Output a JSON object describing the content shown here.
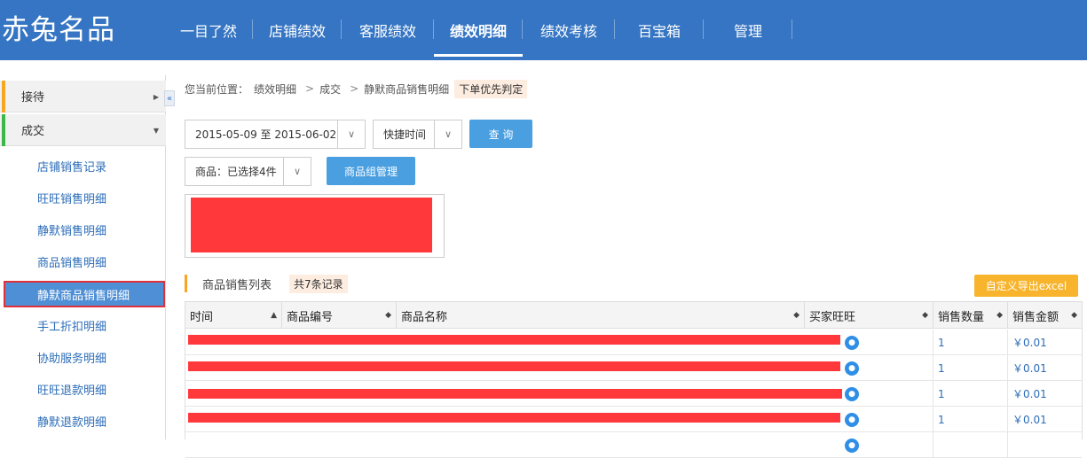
{
  "app": {
    "logo": "赤兔名品"
  },
  "nav": [
    {
      "label": "一目了然"
    },
    {
      "label": "店铺绩效"
    },
    {
      "label": "客服绩效"
    },
    {
      "label": "绩效明细"
    },
    {
      "label": "绩效考核"
    },
    {
      "label": "百宝箱"
    },
    {
      "label": "管理"
    }
  ],
  "nav_active": "绩效明细",
  "sidebar": {
    "groups": [
      {
        "label": "接待",
        "color": "#f5a623",
        "arrow": "▶"
      },
      {
        "label": "成交",
        "color": "#3cb84a",
        "arrow": "▼"
      }
    ],
    "collapse": "«",
    "items": [
      {
        "label": "店铺销售记录"
      },
      {
        "label": "旺旺销售明细"
      },
      {
        "label": "静默销售明细"
      },
      {
        "label": "商品销售明细"
      },
      {
        "label": "静默商品销售明细"
      },
      {
        "label": "手工折扣明细"
      },
      {
        "label": "协助服务明细"
      },
      {
        "label": "旺旺退款明细"
      },
      {
        "label": "静默退款明细"
      }
    ],
    "active_item": "静默商品销售明细"
  },
  "breadcrumb": {
    "prefix": "您当前位置：",
    "parts": [
      "绩效明细",
      "成交",
      "静默商品销售明细"
    ],
    "sep": ">",
    "tag": "下单优先判定"
  },
  "filters": {
    "date_range": "2015-05-09 至 2015-06-02",
    "quick_time": "快捷时间",
    "query": "查  询",
    "goods": "商品：已选择4件",
    "goods_group": "商品组管理",
    "dropdown_icon": "chevron-down-icon"
  },
  "list": {
    "title": "商品销售列表",
    "count": "共7条记录",
    "export": "自定义导出excel"
  },
  "table": {
    "columns": [
      "时间",
      "商品编号",
      "商品名称",
      "买家旺旺",
      "销售数量",
      "销售金额"
    ],
    "rows": [
      {
        "qty": "1",
        "amount": "￥0.01"
      },
      {
        "qty": "1",
        "amount": "￥0.01"
      },
      {
        "qty": "1",
        "amount": "￥0.01"
      },
      {
        "qty": "1",
        "amount": "￥0.01"
      },
      {
        "qty": "",
        "amount": ""
      }
    ]
  },
  "colors": {
    "topbar": "#3575c3",
    "accent_blue": "#4a9fe0",
    "link": "#2b6cb7",
    "orange": "#f7b42c",
    "redaction": "#ff383c"
  }
}
